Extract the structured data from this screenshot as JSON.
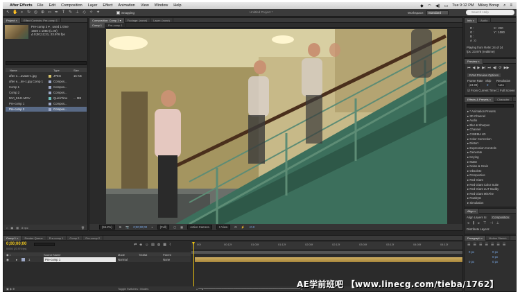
{
  "menubar": {
    "app": "After Effects",
    "items": [
      "File",
      "Edit",
      "Composition",
      "Layer",
      "Effect",
      "Animation",
      "View",
      "Window",
      "Help"
    ],
    "time": "Tue 9:12 PM",
    "user": "Mikey Borup"
  },
  "toolbar": {
    "doc_title": "Untitled Project *",
    "snapping": "Snapping",
    "workspace_label": "Workspace:",
    "workspace_value": "Standard",
    "search_placeholder": "Search Help"
  },
  "project": {
    "tabs": [
      "Project ×",
      "Effect Controls: Pre-comp 1"
    ],
    "selected_name": "Pre-comp 2 ▾ , used 1 time",
    "info1": "1920 x 1080 (1.00)",
    "info2": "Δ 0;00;12;21, 23.976 fps",
    "columns": {
      "name": "Name",
      "type": "Type",
      "size": "Size"
    },
    "items": [
      {
        "name": "after e....avatar-1.jpg",
        "type": "JPEG",
        "size": "15 KB",
        "color": "#d7c46a"
      },
      {
        "name": "after e....ter-1.jpg Comp 1",
        "type": "Compos...",
        "size": "",
        "color": "#9da8c7"
      },
      {
        "name": "Comp 1",
        "type": "Compos...",
        "size": "",
        "color": "#9da8c7"
      },
      {
        "name": "Comp 2",
        "type": "Compos...",
        "size": "",
        "color": "#9da8c7"
      },
      {
        "name": "MVI_5141.MOV",
        "type": "QuickTime",
        "size": "... MB",
        "color": "#6fbfbd"
      },
      {
        "name": "Pre-comp 1",
        "type": "Compos...",
        "size": "",
        "color": "#9da8c7"
      },
      {
        "name": "Pre-comp 2",
        "type": "Compos...",
        "size": "",
        "color": "#9da8c7"
      }
    ],
    "footer": "8 bpc"
  },
  "comp": {
    "tabs": [
      "Composition: Comp 1 ▾",
      "Footage: (none)",
      "Layer: (none)"
    ],
    "subtabs": [
      "Comp 1",
      "Pre-comp 1"
    ],
    "footer": {
      "zoom": "(55.2%)",
      "time": "0;00;00;00",
      "quality": "(Full)",
      "camera": "Active Camera",
      "views": "1 View",
      "exposure": "+0.0"
    }
  },
  "info": {
    "tabs": [
      "Info ×",
      "Audio"
    ],
    "r": "R :",
    "g": "G :",
    "b": "B :",
    "a": "A : 0",
    "x": "X : 230",
    "y": "Y : 1080",
    "playing": "Playing from RAM: 24 of 24",
    "fps": "fps: 23.976 (realtime)"
  },
  "preview": {
    "tab": "Preview ×",
    "ram_options": "RAM Preview Options",
    "frame_rate": "Frame Rate",
    "skip": "Skip",
    "resolution": "Resolution",
    "fr_value": "(23.98)",
    "skip_value": "0",
    "res_value": "Auto",
    "from_current": "From Current Time",
    "full_screen": "Full Screen"
  },
  "effects": {
    "tabs": [
      "Effects & Presets ×",
      "Character"
    ],
    "items": [
      "* Animation Presets",
      "3D Channel",
      "Audio",
      "Blur & Sharpen",
      "Channel",
      "CINEMA 4D",
      "Color Correction",
      "Distort",
      "Expression Controls",
      "Generate",
      "Keying",
      "Matte",
      "Noise & Grain",
      "Obsolete",
      "Perspective",
      "Red Giant",
      "Red Giant Color Suite",
      "Red Giant LUT Buddy",
      "Red Giant MisFire",
      "Rowbyte",
      "Simulation"
    ]
  },
  "align": {
    "tab": "Align ×",
    "align_to": "Align Layers to:",
    "align_value": "Composition",
    "distribute": "Distribute Layers:"
  },
  "paragraph": {
    "tabs": [
      "Paragraph ×",
      "Motion Sketch"
    ],
    "v1": "0 px",
    "v2": "0 px",
    "v3": "0 px",
    "v4": "0 px",
    "v5": "0 px"
  },
  "timeline": {
    "tabs": [
      "Comp 1 ×",
      "Render Queue",
      "Pre-comp 1",
      "Comp 2",
      "Pre-comp 2"
    ],
    "timecode": "0;00;00;00",
    "fps": "00000 (23.976 fps)",
    "columns": {
      "source": "Source Name",
      "mode": "Mode",
      "track": "TrkMat",
      "parent": "Parent"
    },
    "layer": {
      "index": "1",
      "name": "Pre-comp 1",
      "mode": "Normal",
      "parent": "None"
    },
    "ruler": [
      "00f",
      "00:12f",
      "01:00f",
      "01:12f",
      "02:00f",
      "02:12f",
      "03:00f",
      "03:12f",
      "04:00f",
      "04:12f"
    ],
    "footer": "Toggle Switches / Modes"
  },
  "watermark": "AE学前班吧 【www.linecg.com/tieba/1762】"
}
